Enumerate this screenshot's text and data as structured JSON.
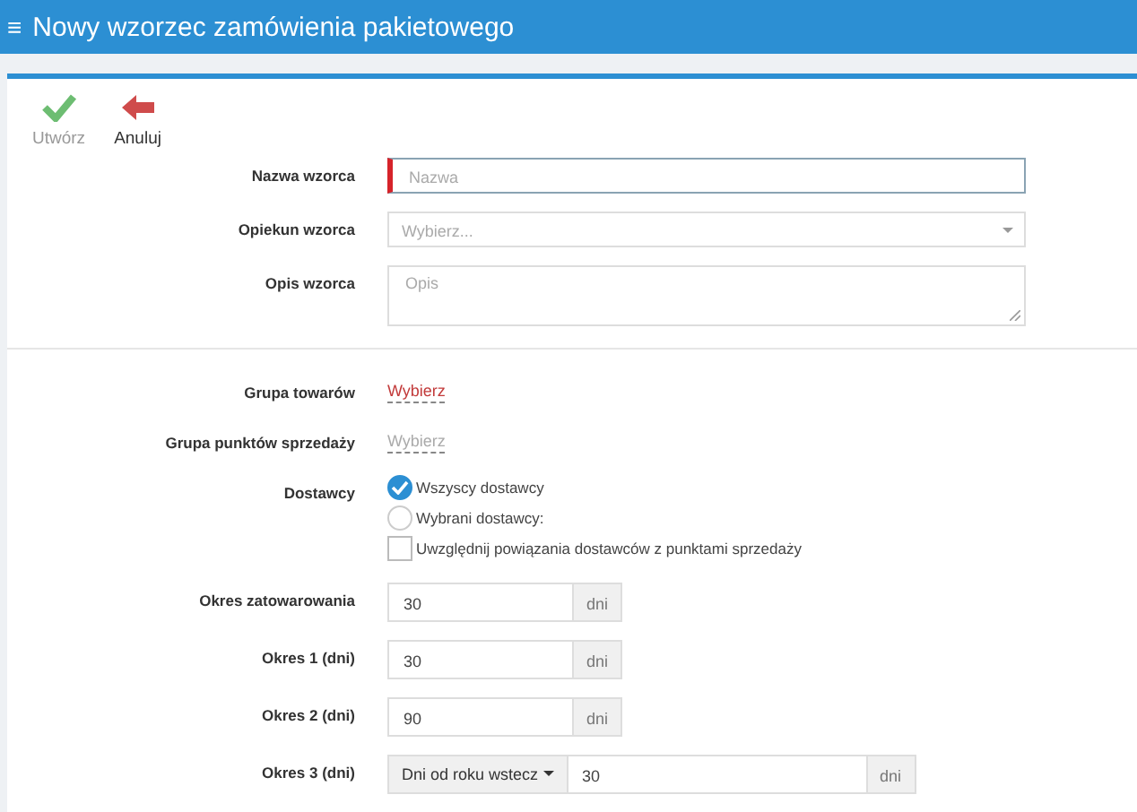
{
  "header": {
    "menu_glyph": "≡",
    "title": "Nowy wzorzec zamówienia pakietowego"
  },
  "toolbar": [
    {
      "label": "Utwórz",
      "kind": "confirm",
      "disabled": true
    },
    {
      "label": "Anuluj",
      "kind": "cancel",
      "disabled": false
    }
  ],
  "top_fields": [
    {
      "kind": "text",
      "label": "Nazwa wzorca",
      "placeholder": "Nazwa",
      "required": true
    },
    {
      "kind": "select",
      "label": "Opiekun wzorca",
      "placeholder": "Wybierz..."
    },
    {
      "kind": "textarea",
      "label": "Opis wzorca",
      "placeholder": "Opis"
    }
  ],
  "bottom_fields": [
    {
      "kind": "link",
      "label": "Grupa towarów",
      "value": "Wybierz",
      "disabled": false
    },
    {
      "kind": "link",
      "label": "Grupa punktów sprzedaży",
      "value": "Wybierz",
      "disabled": true
    },
    {
      "kind": "choices",
      "label": "Dostawcy",
      "options": [
        {
          "kind": "radio",
          "label": "Wszyscy dostawcy",
          "selected": true
        },
        {
          "kind": "radio",
          "label": "Wybrani dostawcy:",
          "selected": false
        },
        {
          "kind": "checkbox",
          "label": "Uwzględnij powiązania dostawców z punktami sprzedaży",
          "checked": false
        }
      ]
    },
    {
      "kind": "number",
      "label": "Okres zatowarowania",
      "value": "30",
      "unit": "dni"
    },
    {
      "kind": "number",
      "label": "Okres 1 (dni)",
      "value": "30",
      "unit": "dni"
    },
    {
      "kind": "number",
      "label": "Okres 2 (dni)",
      "value": "90",
      "unit": "dni"
    },
    {
      "kind": "combo",
      "label": "Okres 3 (dni)",
      "dropdown": "Dni od roku wstecz",
      "value": "30",
      "unit": "dni"
    }
  ]
}
